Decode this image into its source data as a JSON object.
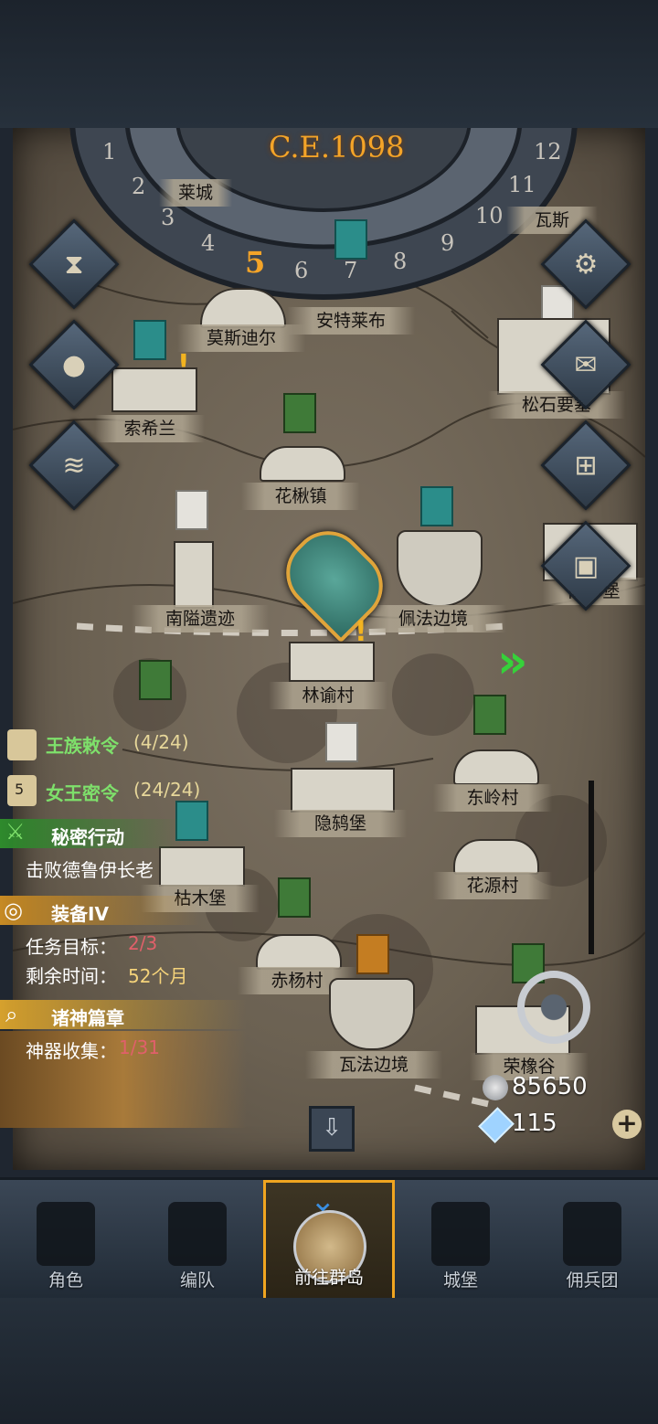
{
  "era": "C.E.1098",
  "calendar": {
    "months": [
      "1",
      "2",
      "3",
      "4",
      "5",
      "6",
      "7",
      "8",
      "9",
      "10",
      "11",
      "12"
    ],
    "current_month": "5"
  },
  "locations": [
    {
      "name": "莫斯迪尔"
    },
    {
      "name": "安特莱布"
    },
    {
      "name": "索希兰"
    },
    {
      "name": "松石要塞"
    },
    {
      "name": "花楸镇"
    },
    {
      "name": "南隘遗迹"
    },
    {
      "name": "佩法边境"
    },
    {
      "name": "萨尔堡"
    },
    {
      "name": "林谕村"
    },
    {
      "name": "隐鸫堡"
    },
    {
      "name": "东岭村"
    },
    {
      "name": "花源村"
    },
    {
      "name": "枯木堡"
    },
    {
      "name": "赤杨村"
    },
    {
      "name": "瓦法边境"
    },
    {
      "name": "荣橡谷"
    },
    {
      "name": "瓦斯"
    },
    {
      "name": "莱城"
    }
  ],
  "quests": {
    "royal": {
      "title": "王族敕令",
      "progress": "(4/24)"
    },
    "queen": {
      "title": "女王密令",
      "progress": "(24/24)",
      "badge": "5"
    },
    "secret": {
      "title": "秘密行动",
      "desc": "击败德鲁伊长老"
    },
    "equip": {
      "title": "装备IV",
      "target_label": "任务目标：",
      "target_value": "2/3",
      "time_label": "剩余时间：",
      "time_value": "52个月"
    },
    "gods": {
      "title": "诸神篇章",
      "collect_label": "神器收集：",
      "collect_value": "1/31"
    }
  },
  "currency": {
    "silver": "85650",
    "crystal": "115"
  },
  "tabs": [
    {
      "label": "角色"
    },
    {
      "label": "编队"
    },
    {
      "label": "前往群岛"
    },
    {
      "label": "城堡"
    },
    {
      "label": "佣兵团"
    }
  ],
  "colors": {
    "accent": "#f0a520",
    "quest_green": "#7ee06b",
    "progress_red": "#e0606a"
  }
}
